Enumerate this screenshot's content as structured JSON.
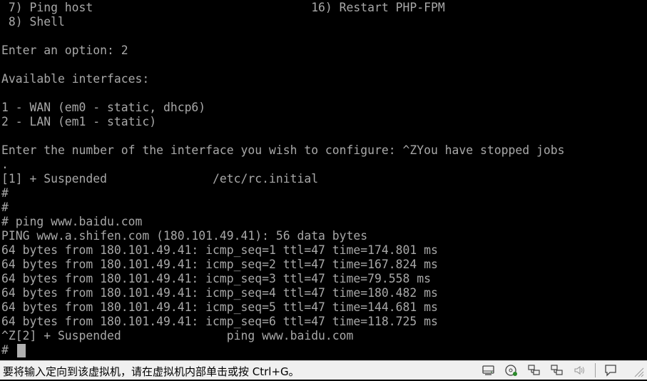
{
  "console": {
    "lines": [
      " 7) Ping host                               16) Restart PHP-FPM",
      " 8) Shell",
      "",
      "Enter an option: 2",
      "",
      "Available interfaces:",
      "",
      "1 - WAN (em0 - static, dhcp6)",
      "2 - LAN (em1 - static)",
      "",
      "Enter the number of the interface you wish to configure: ^ZYou have stopped jobs",
      ".",
      "[1] + Suspended               /etc/rc.initial",
      "#",
      "#",
      "# ping www.baidu.com",
      "PING www.a.shifen.com (180.101.49.41): 56 data bytes",
      "64 bytes from 180.101.49.41: icmp_seq=1 ttl=47 time=174.801 ms",
      "64 bytes from 180.101.49.41: icmp_seq=2 ttl=47 time=167.824 ms",
      "64 bytes from 180.101.49.41: icmp_seq=3 ttl=47 time=79.558 ms",
      "64 bytes from 180.101.49.41: icmp_seq=4 ttl=47 time=180.482 ms",
      "64 bytes from 180.101.49.41: icmp_seq=5 ttl=47 time=144.681 ms",
      "64 bytes from 180.101.49.41: icmp_seq=6 ttl=47 time=118.725 ms",
      "^Z[2] + Suspended               ping www.baidu.com",
      "# "
    ]
  },
  "statusbar": {
    "message": "要将输入定向到该虚拟机，请在虚拟机内部单击或按 Ctrl+G。",
    "icons": [
      "hard-disk-icon",
      "cd-drive-icon",
      "network-adapter-1-icon",
      "network-adapter-2-icon",
      "sound-icon",
      "message-icon",
      "resize-grip-icon"
    ]
  },
  "colors": {
    "console_bg": "#000000",
    "console_fg": "#a8a8a8",
    "statusbar_bg": "#f0f0f0"
  }
}
